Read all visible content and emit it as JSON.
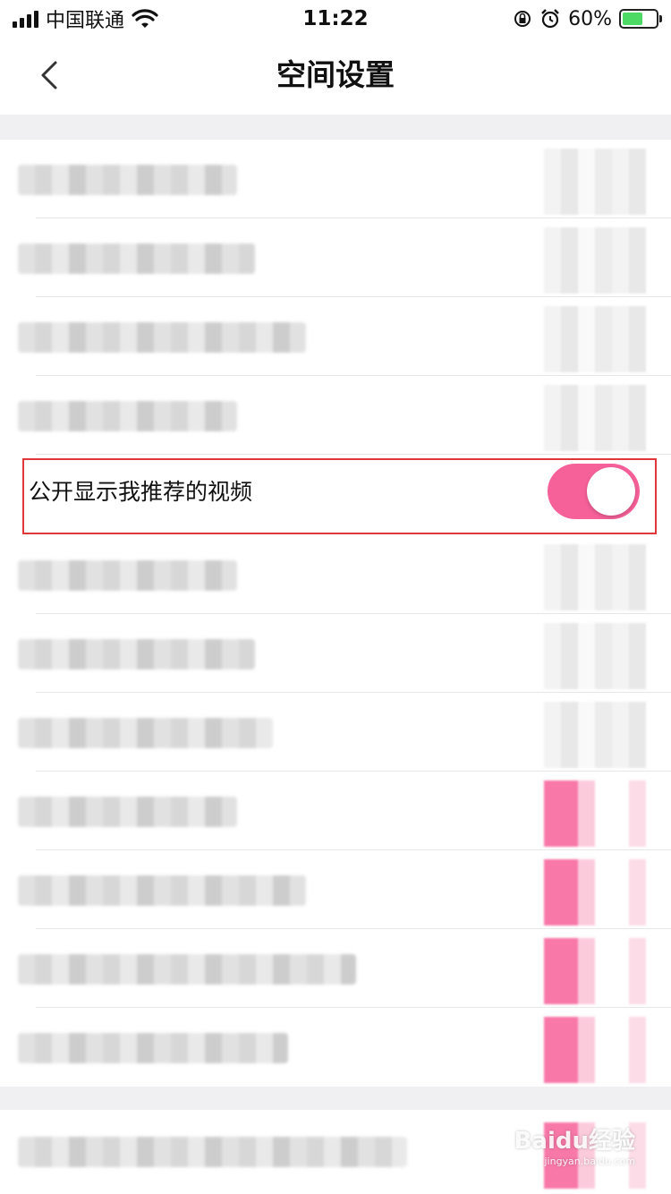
{
  "status_bar": {
    "carrier": "中国联通",
    "time": "11:22",
    "battery_percent": "60%",
    "battery_level": 0.6,
    "icons": [
      "signal-icon",
      "wifi-icon",
      "orientation-lock-icon",
      "alarm-icon",
      "battery-charging-icon"
    ]
  },
  "nav": {
    "title": "空间设置",
    "back_icon": "chevron-left-icon"
  },
  "settings": {
    "highlighted_item": {
      "label": "公开显示我推荐的视频",
      "toggle_on": true
    }
  },
  "colors": {
    "accent": "#f7619a",
    "highlight_border": "#e0383a",
    "separator": "#f0f0f2"
  },
  "watermark": {
    "brand": "Baidu经验",
    "url": "jingyan.baidu.com"
  }
}
